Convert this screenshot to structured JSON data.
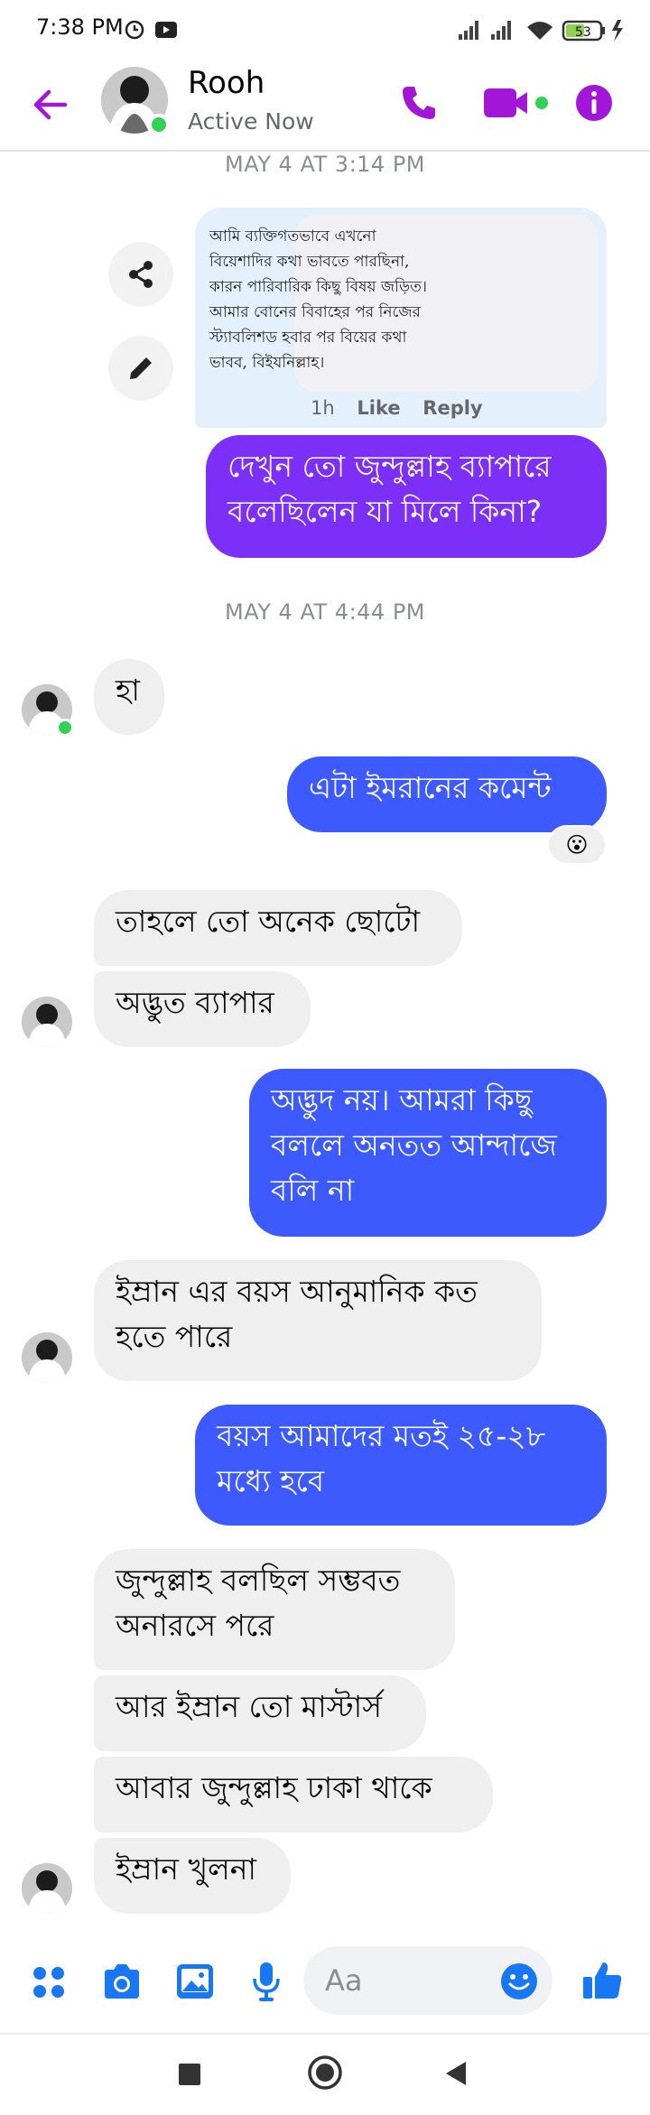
{
  "status_bar": {
    "time": "7:38 PM",
    "battery": "53"
  },
  "header": {
    "name": "Rooh",
    "status": "Active Now"
  },
  "colors": {
    "accent": "#a116d7",
    "outgoing": "#3d5afe",
    "outgoing_purple": "#7b2ff7",
    "incoming": "#efefef",
    "online": "#31d158"
  },
  "shared_post": {
    "lines": [
      "আমি ব্যক্তিগতভাবে এখনো",
      "বিয়েশাদির কথা ভাবতে পারছিনা,",
      "কারন পারিবারিক কিছু বিষয় জড়িত।",
      "আমার বোনের বিবাহের পর নিজের",
      "স্ট্যাবলিশড হবার পর বিয়ের কথা",
      "ভাবব, বিইযনিল্লাহ।"
    ],
    "time": "1h",
    "like": "Like",
    "reply": "Reply"
  },
  "dates": [
    "MAY 4 AT 3:14 PM",
    "MAY 4 AT 4:44 PM"
  ],
  "messages": [
    {
      "from": "me",
      "lines": [
        "দেখুন তো জুন্দুল্লাহ ব্যাপারে",
        "বলেছিলেন যা মিলে কিনা?"
      ]
    },
    {
      "from": "them",
      "lines": [
        "হা"
      ]
    },
    {
      "from": "me",
      "lines": [
        "এটা ইমরানের কমেন্ট"
      ],
      "reaction": "😮"
    },
    {
      "from": "them",
      "lines": [
        "তাহলে তো অনেক ছোটো"
      ]
    },
    {
      "from": "them",
      "lines": [
        "অদ্ভুত ব্যাপার"
      ]
    },
    {
      "from": "me",
      "lines": [
        "অদ্ভুদ নয়। আমরা কিছু",
        "বললে অনতত আন্দাজে",
        "বলি না"
      ]
    },
    {
      "from": "them",
      "lines": [
        "ইম্রান এর বয়স আনুমানিক কত",
        "হতে পারে"
      ]
    },
    {
      "from": "me",
      "lines": [
        "বয়স আমাদের মতই ২৫-২৮",
        "মধ্যে হবে"
      ]
    },
    {
      "from": "them",
      "lines": [
        "জুন্দুল্লাহ বলছিল সম্ভবত",
        "অনারসে পরে"
      ]
    },
    {
      "from": "them",
      "lines": [
        "আর ইম্রান তো মাস্টার্স"
      ]
    },
    {
      "from": "them",
      "lines": [
        "আবার জুন্দুল্লাহ ঢাকা থাকে"
      ]
    },
    {
      "from": "them",
      "lines": [
        "ইম্রান খুলনা"
      ]
    }
  ],
  "composer": {
    "placeholder": "Aa"
  },
  "icons": {
    "header": [
      "back-arrow-icon",
      "phone-icon",
      "video-camera-icon",
      "info-icon"
    ],
    "composer": [
      "apps-icon",
      "camera-icon",
      "gallery-icon",
      "microphone-icon",
      "emoji-icon",
      "thumbs-up-icon"
    ],
    "nav": [
      "recents-icon",
      "home-icon",
      "back-icon"
    ]
  }
}
